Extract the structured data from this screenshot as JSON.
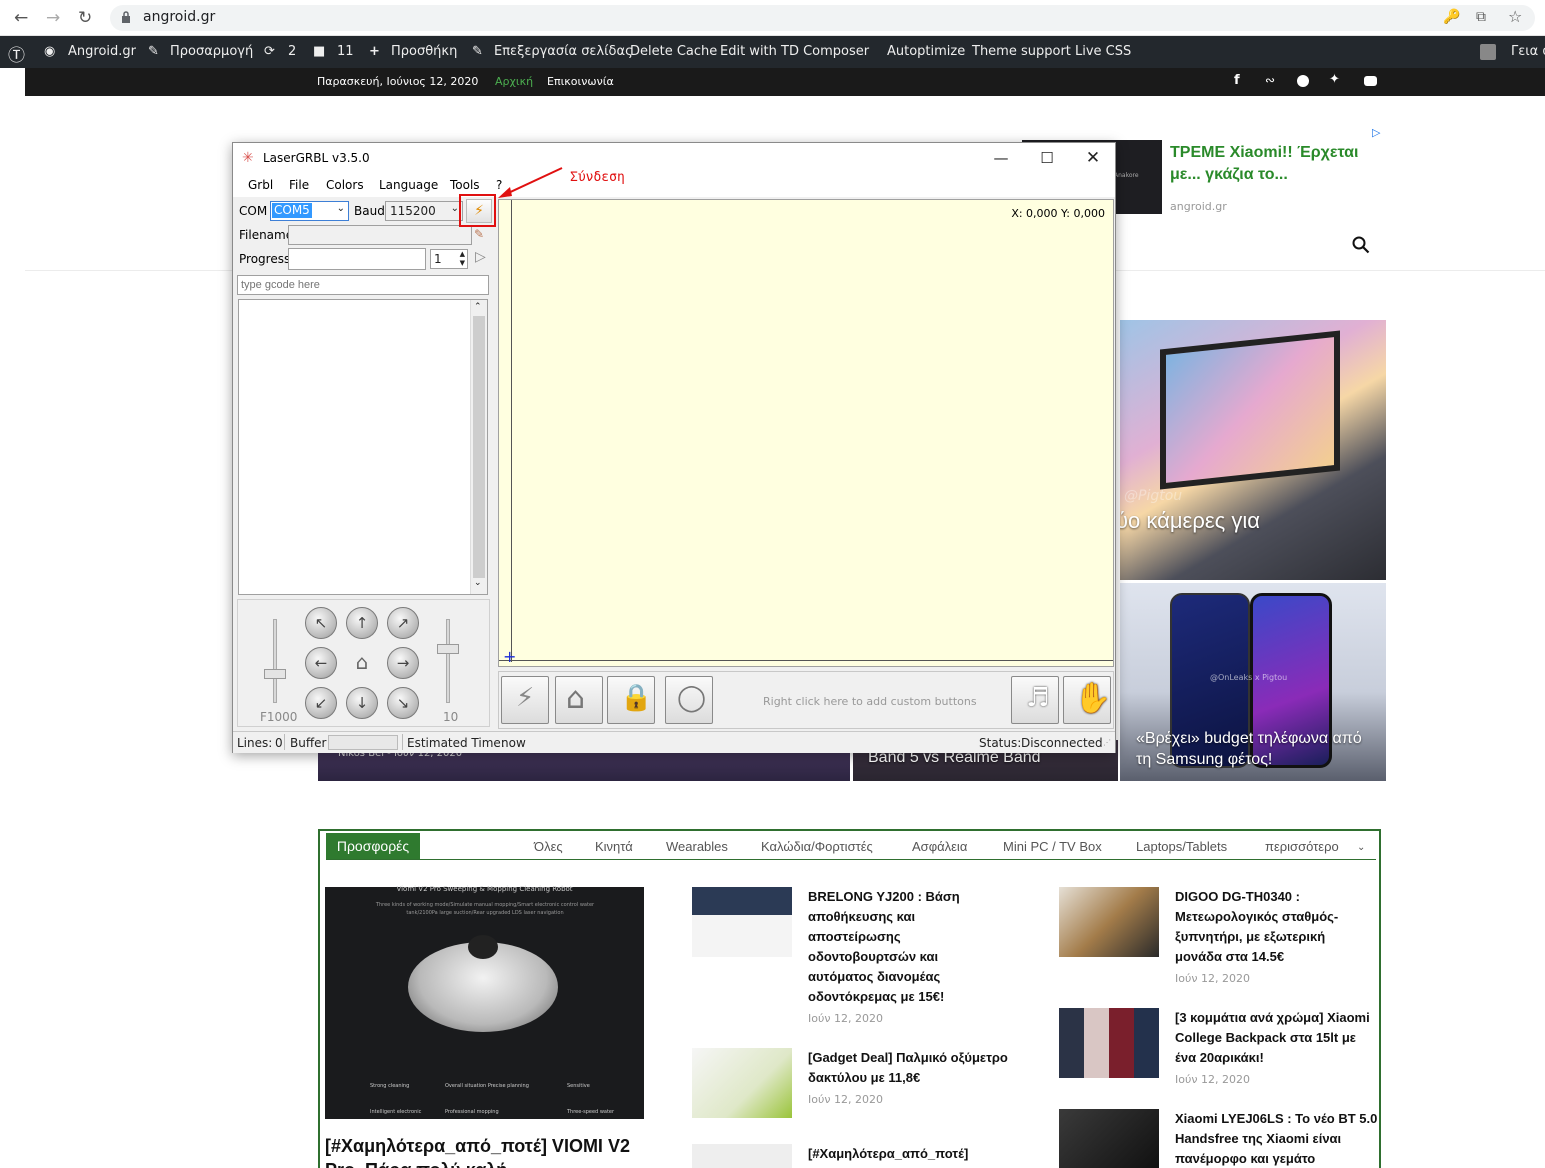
{
  "browser": {
    "url": "angroid.gr",
    "icons": [
      "back-icon",
      "forward-icon",
      "reload-icon",
      "lock-icon",
      "key-icon",
      "share-icon",
      "star-icon"
    ]
  },
  "wp_admin": {
    "site": "Angroid.gr",
    "customize": "Προσαρμογή",
    "updates": "2",
    "comments": "11",
    "new": "Προσθήκη",
    "edit": "Επεξεργασία σελίδας",
    "delete_cache": "Delete Cache",
    "td_composer": "Edit with TD Composer",
    "autoptimize": "Autoptimize",
    "theme_support": "Theme support",
    "live_css": "Live CSS",
    "greeting": "Γεια σ"
  },
  "top_strip": {
    "date": "Παρασκευή, Ιούνιος 12, 2020",
    "home": "Αρχική",
    "contact": "Επικοινωνία",
    "social": [
      "facebook-icon",
      "rss-icon",
      "telegram-icon",
      "twitter-icon",
      "youtube-icon"
    ]
  },
  "ad": {
    "title": "ΤΡΕΜΕ Xiaomi!! Έρχεται με... γκάζια το...",
    "source": "angroid.gr",
    "thumb_text": "Anakore"
  },
  "heroes": {
    "tablet_caption": "ύο κάμερες για",
    "tablet_watermark": "@Pigtou",
    "phone_caption": "«Βρέχει» budget τηλέφωνα από τη Samsung φέτος!",
    "phone_watermark": "@OnLeaks x Pigtou",
    "mid_caption": "Band 5 vs Realme Band",
    "left_meta": "Nikos Bel - Ιούν 12, 2020"
  },
  "laser": {
    "title": "LaserGRBL v3.5.0",
    "menu": [
      "Grbl",
      "File",
      "Colors",
      "Language",
      "Tools",
      "?"
    ],
    "com_label": "COM",
    "com_value": "COM5",
    "baud_label": "Baud",
    "baud_value": "115200",
    "filename_label": "Filename",
    "progress_label": "Progress",
    "progress_count": "1",
    "gcode_placeholder": "type gcode here",
    "coords": "X: 0,000 Y: 0,000",
    "speed_label": "F1000",
    "step_label": "10",
    "custom_hint": "Right click here to add custom buttons",
    "lines_label": "Lines:",
    "lines_value": "0",
    "buffer_label": "Buffer",
    "estimated_label": "Estimated Time:",
    "estimated_value": "now",
    "status_label": "Status:",
    "status_value": "Disconnected"
  },
  "annotation": {
    "label": "Σύνδεση"
  },
  "offers": {
    "tab": "Προσφορές",
    "filters": [
      "Όλες",
      "Κινητά",
      "Wearables",
      "Καλώδια/Φορτιστές",
      "Ασφάλεια",
      "Mini PC / TV Box",
      "Laptops/Tablets",
      "περισσότερο"
    ],
    "featured_title": "[#Χαμηλότερα_από_ποτέ] VIOMI V2 Pro, Πάρα πολύ καλή",
    "featured_banner": "Viomi V2 Pro Sweeping & Mopping Cleaning Robot",
    "featured_sub": "Three kinds of working mode/Simulate manual mopping/Smart electronic control water tank/2100Pa large suction/Rear upgraded LDS laser navigation",
    "featured_spec1": "Strong cleaning",
    "featured_spec2": "Overall situation Precise planning",
    "featured_spec3": "Sensitive",
    "featured_spec4": "Intelligent electronic",
    "featured_spec5": "Professional mopping",
    "featured_spec6": "Three-speed water",
    "col2": [
      {
        "title": "BRELONG YJ200 : Βάση αποθήκευσης και αποστείρωσης οδοντοβουρτσών και αυτόματος διανομέας οδοντόκρεμας με 15€!",
        "date": "Ιούν 12, 2020"
      },
      {
        "title": "[Gadget Deal] Παλμικό οξύμετρο δακτύλου με 11,8€",
        "date": "Ιούν 12, 2020"
      },
      {
        "title": "[#Χαμηλότερα_από_ποτέ]",
        "date": ""
      }
    ],
    "col3": [
      {
        "title": "DIGOO DG-TH0340 : Μετεωρολογικός σταθμός-ξυπνητήρι, με εξωτερική μονάδα στα 14.5€",
        "date": "Ιούν 12, 2020"
      },
      {
        "title": "[3 κομμάτια ανά χρώμα] Xiaomi College Backpack στα 15lt με ένα 20αρικάκι!",
        "date": "Ιούν 12, 2020"
      },
      {
        "title": "Xiaomi LYEJ06LS : Το νέο BT 5.0 Handsfree της Xiaomi είναι πανέμορφο και γεμάτο",
        "date": ""
      }
    ]
  },
  "colors": {
    "wp_bar": "#23282d",
    "accent_green": "#2f7a2f",
    "annotation_red": "#e01010",
    "canvas": "#ffffe0"
  }
}
